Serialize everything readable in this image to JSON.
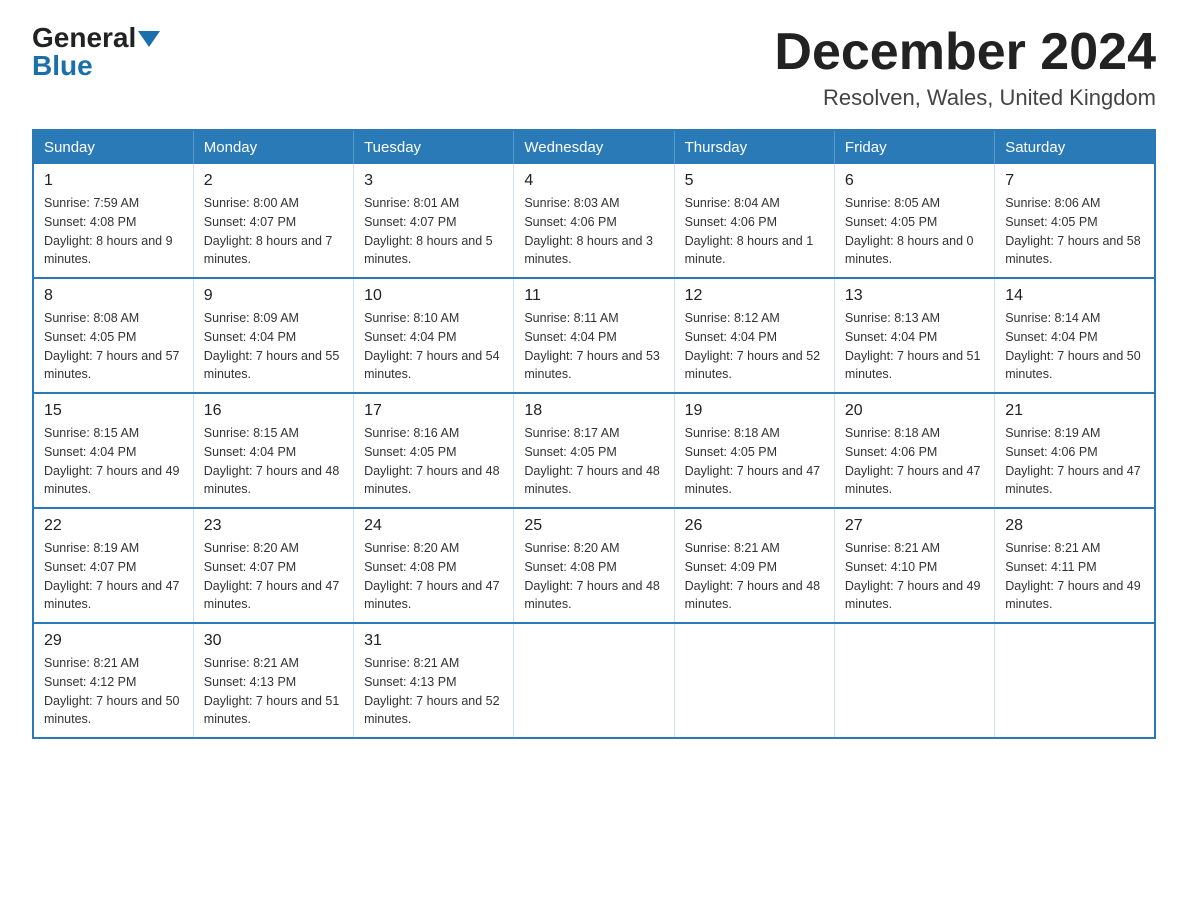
{
  "header": {
    "logo_general": "General",
    "logo_blue": "Blue",
    "month_title": "December 2024",
    "location": "Resolven, Wales, United Kingdom"
  },
  "days_of_week": [
    "Sunday",
    "Monday",
    "Tuesday",
    "Wednesday",
    "Thursday",
    "Friday",
    "Saturday"
  ],
  "weeks": [
    [
      {
        "day": "1",
        "sunrise": "7:59 AM",
        "sunset": "4:08 PM",
        "daylight": "8 hours and 9 minutes."
      },
      {
        "day": "2",
        "sunrise": "8:00 AM",
        "sunset": "4:07 PM",
        "daylight": "8 hours and 7 minutes."
      },
      {
        "day": "3",
        "sunrise": "8:01 AM",
        "sunset": "4:07 PM",
        "daylight": "8 hours and 5 minutes."
      },
      {
        "day": "4",
        "sunrise": "8:03 AM",
        "sunset": "4:06 PM",
        "daylight": "8 hours and 3 minutes."
      },
      {
        "day": "5",
        "sunrise": "8:04 AM",
        "sunset": "4:06 PM",
        "daylight": "8 hours and 1 minute."
      },
      {
        "day": "6",
        "sunrise": "8:05 AM",
        "sunset": "4:05 PM",
        "daylight": "8 hours and 0 minutes."
      },
      {
        "day": "7",
        "sunrise": "8:06 AM",
        "sunset": "4:05 PM",
        "daylight": "7 hours and 58 minutes."
      }
    ],
    [
      {
        "day": "8",
        "sunrise": "8:08 AM",
        "sunset": "4:05 PM",
        "daylight": "7 hours and 57 minutes."
      },
      {
        "day": "9",
        "sunrise": "8:09 AM",
        "sunset": "4:04 PM",
        "daylight": "7 hours and 55 minutes."
      },
      {
        "day": "10",
        "sunrise": "8:10 AM",
        "sunset": "4:04 PM",
        "daylight": "7 hours and 54 minutes."
      },
      {
        "day": "11",
        "sunrise": "8:11 AM",
        "sunset": "4:04 PM",
        "daylight": "7 hours and 53 minutes."
      },
      {
        "day": "12",
        "sunrise": "8:12 AM",
        "sunset": "4:04 PM",
        "daylight": "7 hours and 52 minutes."
      },
      {
        "day": "13",
        "sunrise": "8:13 AM",
        "sunset": "4:04 PM",
        "daylight": "7 hours and 51 minutes."
      },
      {
        "day": "14",
        "sunrise": "8:14 AM",
        "sunset": "4:04 PM",
        "daylight": "7 hours and 50 minutes."
      }
    ],
    [
      {
        "day": "15",
        "sunrise": "8:15 AM",
        "sunset": "4:04 PM",
        "daylight": "7 hours and 49 minutes."
      },
      {
        "day": "16",
        "sunrise": "8:15 AM",
        "sunset": "4:04 PM",
        "daylight": "7 hours and 48 minutes."
      },
      {
        "day": "17",
        "sunrise": "8:16 AM",
        "sunset": "4:05 PM",
        "daylight": "7 hours and 48 minutes."
      },
      {
        "day": "18",
        "sunrise": "8:17 AM",
        "sunset": "4:05 PM",
        "daylight": "7 hours and 48 minutes."
      },
      {
        "day": "19",
        "sunrise": "8:18 AM",
        "sunset": "4:05 PM",
        "daylight": "7 hours and 47 minutes."
      },
      {
        "day": "20",
        "sunrise": "8:18 AM",
        "sunset": "4:06 PM",
        "daylight": "7 hours and 47 minutes."
      },
      {
        "day": "21",
        "sunrise": "8:19 AM",
        "sunset": "4:06 PM",
        "daylight": "7 hours and 47 minutes."
      }
    ],
    [
      {
        "day": "22",
        "sunrise": "8:19 AM",
        "sunset": "4:07 PM",
        "daylight": "7 hours and 47 minutes."
      },
      {
        "day": "23",
        "sunrise": "8:20 AM",
        "sunset": "4:07 PM",
        "daylight": "7 hours and 47 minutes."
      },
      {
        "day": "24",
        "sunrise": "8:20 AM",
        "sunset": "4:08 PM",
        "daylight": "7 hours and 47 minutes."
      },
      {
        "day": "25",
        "sunrise": "8:20 AM",
        "sunset": "4:08 PM",
        "daylight": "7 hours and 48 minutes."
      },
      {
        "day": "26",
        "sunrise": "8:21 AM",
        "sunset": "4:09 PM",
        "daylight": "7 hours and 48 minutes."
      },
      {
        "day": "27",
        "sunrise": "8:21 AM",
        "sunset": "4:10 PM",
        "daylight": "7 hours and 49 minutes."
      },
      {
        "day": "28",
        "sunrise": "8:21 AM",
        "sunset": "4:11 PM",
        "daylight": "7 hours and 49 minutes."
      }
    ],
    [
      {
        "day": "29",
        "sunrise": "8:21 AM",
        "sunset": "4:12 PM",
        "daylight": "7 hours and 50 minutes."
      },
      {
        "day": "30",
        "sunrise": "8:21 AM",
        "sunset": "4:13 PM",
        "daylight": "7 hours and 51 minutes."
      },
      {
        "day": "31",
        "sunrise": "8:21 AM",
        "sunset": "4:13 PM",
        "daylight": "7 hours and 52 minutes."
      },
      null,
      null,
      null,
      null
    ]
  ],
  "labels": {
    "sunrise": "Sunrise:",
    "sunset": "Sunset:",
    "daylight": "Daylight:"
  }
}
